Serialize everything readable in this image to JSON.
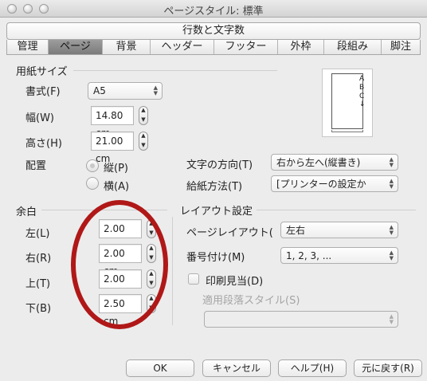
{
  "window": {
    "title": "ページスタイル: 標準"
  },
  "tabs": {
    "top": "行数と文字数",
    "row": [
      "管理",
      "ページ",
      "背景",
      "ヘッダー",
      "フッター",
      "外枠",
      "段組み",
      "脚注"
    ]
  },
  "paper": {
    "section_label": "用紙サイズ",
    "format_label": "書式(F)",
    "format_value": "A5",
    "width_label": "幅(W)",
    "width_value": "14.80 cm",
    "height_label": "高さ(H)",
    "height_value": "21.00 cm",
    "orientation_label": "配置",
    "portrait_label": "縦(P)",
    "landscape_label": "横(A)",
    "text_direction_label": "文字の方向(T)",
    "text_direction_value": "右から左へ(縦書き)",
    "paper_tray_label": "給紙方法(T)",
    "paper_tray_value": "[プリンターの設定か"
  },
  "preview": {
    "letters": [
      "A",
      "B",
      "C",
      "↓"
    ]
  },
  "margins": {
    "section_label": "余白",
    "left_label": "左(L)",
    "left_value": "2.00 cm",
    "right_label": "右(R)",
    "right_value": "2.00 cm",
    "top_label": "上(T)",
    "top_value": "2.00 cm",
    "bottom_label": "下(B)",
    "bottom_value": "2.50 cm"
  },
  "layout": {
    "section_label": "レイアウト設定",
    "page_layout_label": "ページレイアウト(",
    "page_layout_value": "左右",
    "numbering_label": "番号付け(M)",
    "numbering_value": "1, 2, 3, ...",
    "register_true_label": "印刷見当(D)",
    "reference_style_label": "適用段落スタイル(S)",
    "reference_style_value": ""
  },
  "buttons": {
    "ok": "OK",
    "cancel": "キャンセル",
    "help": "ヘルプ(H)",
    "reset": "元に戻す(R)"
  },
  "annotation": {
    "color": "#b01818"
  }
}
